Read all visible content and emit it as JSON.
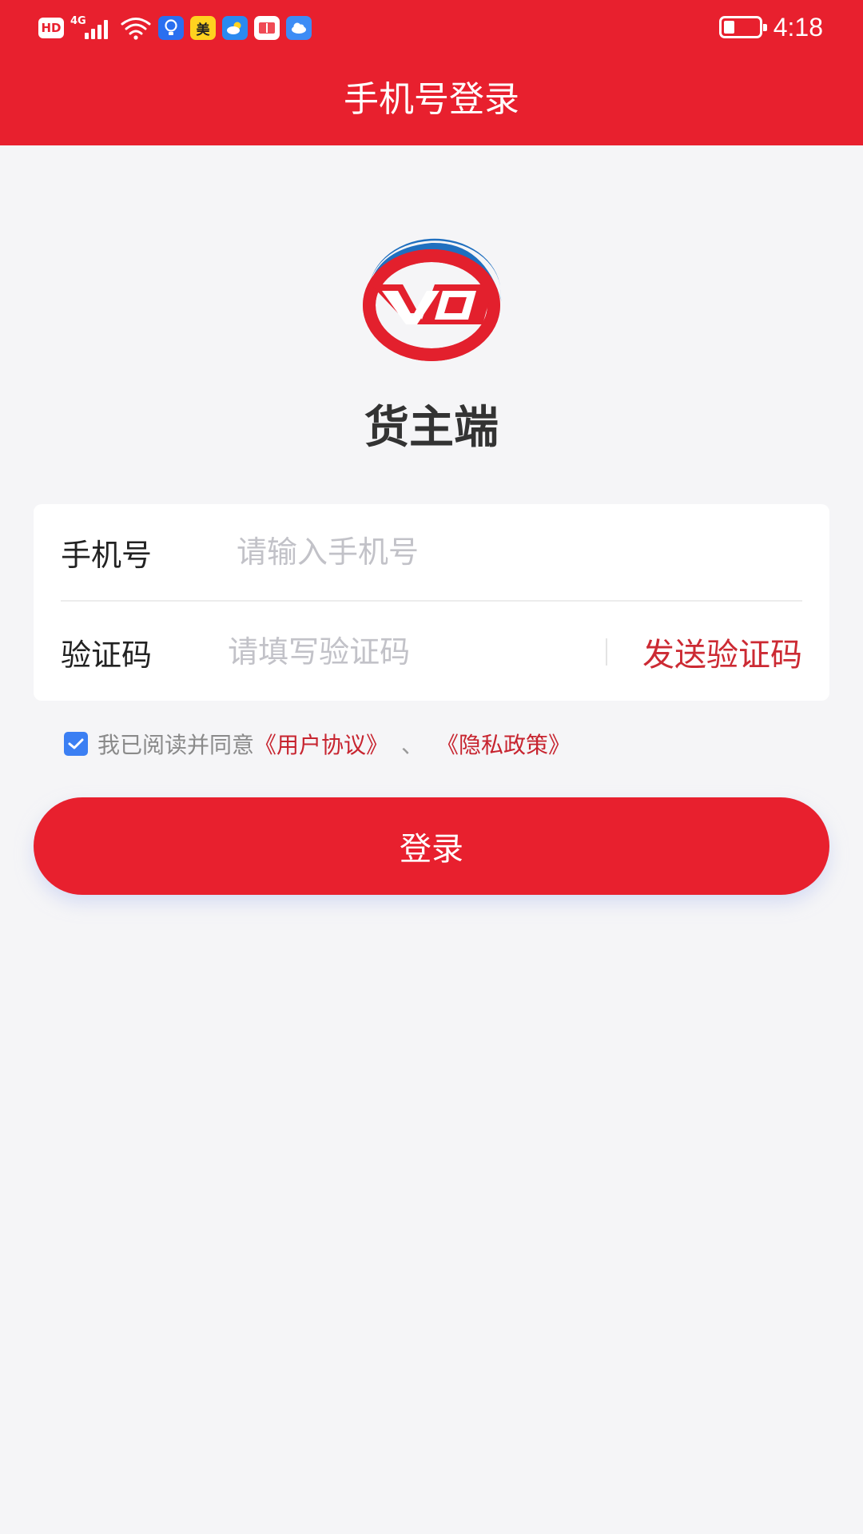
{
  "status_bar": {
    "hd": "HD",
    "network": "4G",
    "app_badge": "美",
    "time": "4:18",
    "battery_level": 0.3
  },
  "header": {
    "title": "手机号登录",
    "color": "#e8202e"
  },
  "brand": {
    "name": "货主端",
    "logo_letters": "VD"
  },
  "form": {
    "phone": {
      "label": "手机号",
      "placeholder": "请输入手机号",
      "value": ""
    },
    "code": {
      "label": "验证码",
      "placeholder": "请填写验证码",
      "value": "",
      "send_label": "发送验证码"
    }
  },
  "agreement": {
    "checked": true,
    "prefix": "我已阅读并同意",
    "user_agreement": "《用户协议》",
    "separator": "、",
    "privacy_policy": "《隐私政策》"
  },
  "login_button": {
    "label": "登录"
  },
  "icons": [
    "hd-icon",
    "signal-icon",
    "wifi-icon",
    "bulb-app-icon",
    "meituan-app-icon",
    "weather-app-icon",
    "book-app-icon",
    "cloud-app-icon",
    "battery-icon",
    "check-icon"
  ]
}
